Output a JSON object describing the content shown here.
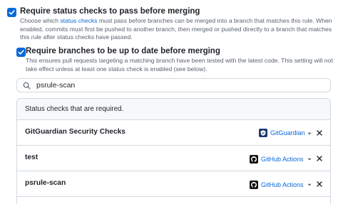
{
  "options": [
    {
      "title": "Require status checks to pass before merging",
      "desc_prefix": "Choose which ",
      "desc_link": "status checks",
      "desc_suffix": " must pass before branches can be merged into a branch that matches this rule. When enabled, commits must first be pushed to another branch, then merged or pushed directly to a branch that matches this rule after status checks have passed.",
      "checked": true
    },
    {
      "title": "Require branches to be up to date before merging",
      "desc": "This ensures pull requests targeting a matching branch have been tested with the latest code. This setting will not take effect unless at least one status check is enabled (see below).",
      "checked": true
    }
  ],
  "search": {
    "value": "psrule-scan",
    "icon": "search-icon"
  },
  "table": {
    "header": "Status checks that are required.",
    "rows": [
      {
        "name": "GitGuardian Security Checks",
        "app": "GitGuardian",
        "app_icon": "gitguardian-icon"
      },
      {
        "name": "test",
        "app": "GitHub Actions",
        "app_icon": "github-actions-icon"
      },
      {
        "name": "psrule-scan",
        "app": "GitHub Actions",
        "app_icon": "github-actions-icon"
      }
    ]
  },
  "colors": {
    "accent": "#0969da",
    "border": "#d1d9e0",
    "muted": "#59636e",
    "header_bg": "#f6f8fa"
  }
}
